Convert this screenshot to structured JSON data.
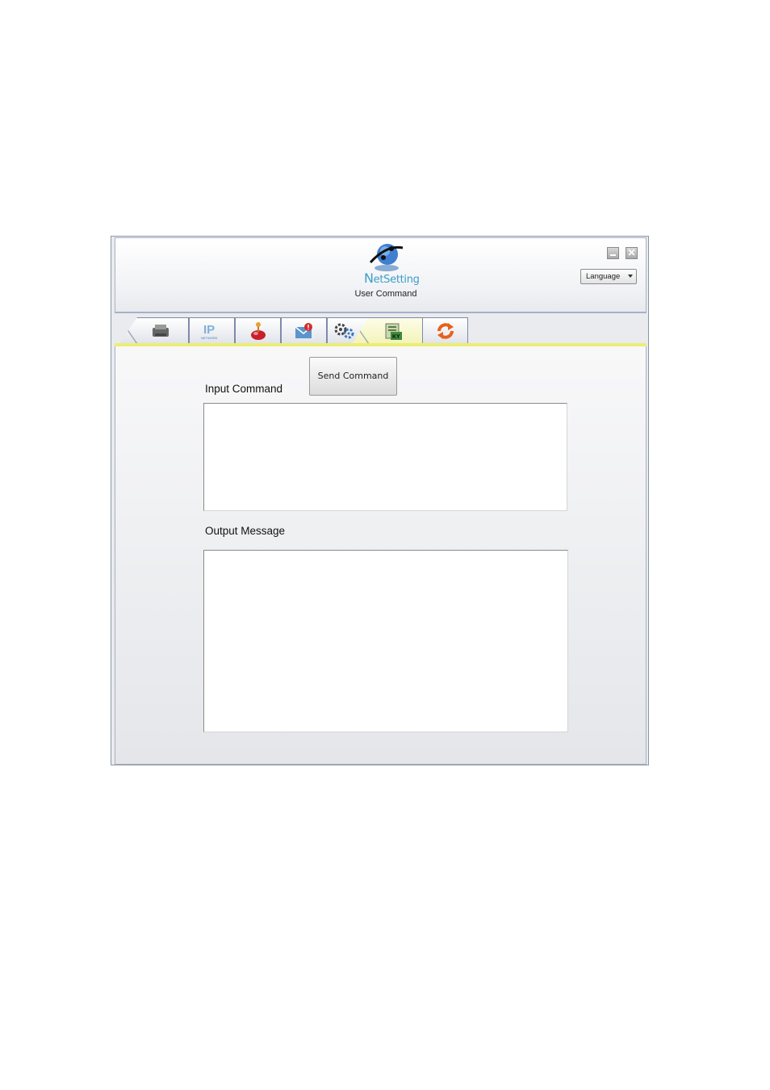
{
  "app": {
    "logo_text_first": "N",
    "logo_text_rest": "etSetting",
    "subtitle": "User Command"
  },
  "window_controls": {
    "minimize_icon": "minimize-icon",
    "close_icon": "close-icon",
    "close_glyph": "✕",
    "language_label": "Language"
  },
  "tabs": [
    {
      "icon": "printer-icon"
    },
    {
      "icon": "ip-network-icon"
    },
    {
      "icon": "alarm-icon"
    },
    {
      "icon": "email-alert-icon"
    },
    {
      "icon": "settings-gears-icon"
    },
    {
      "icon": "user-command-icon",
      "active": true
    },
    {
      "icon": "refresh-icon"
    }
  ],
  "main": {
    "send_button_label": "Send Command",
    "input_label": "Input Command",
    "input_value": "",
    "output_label": "Output Message",
    "output_value": ""
  },
  "colors": {
    "active_tab": "#f3f3b8",
    "accent_line": "#eded74",
    "logo_blue": "#3a9fc9"
  }
}
